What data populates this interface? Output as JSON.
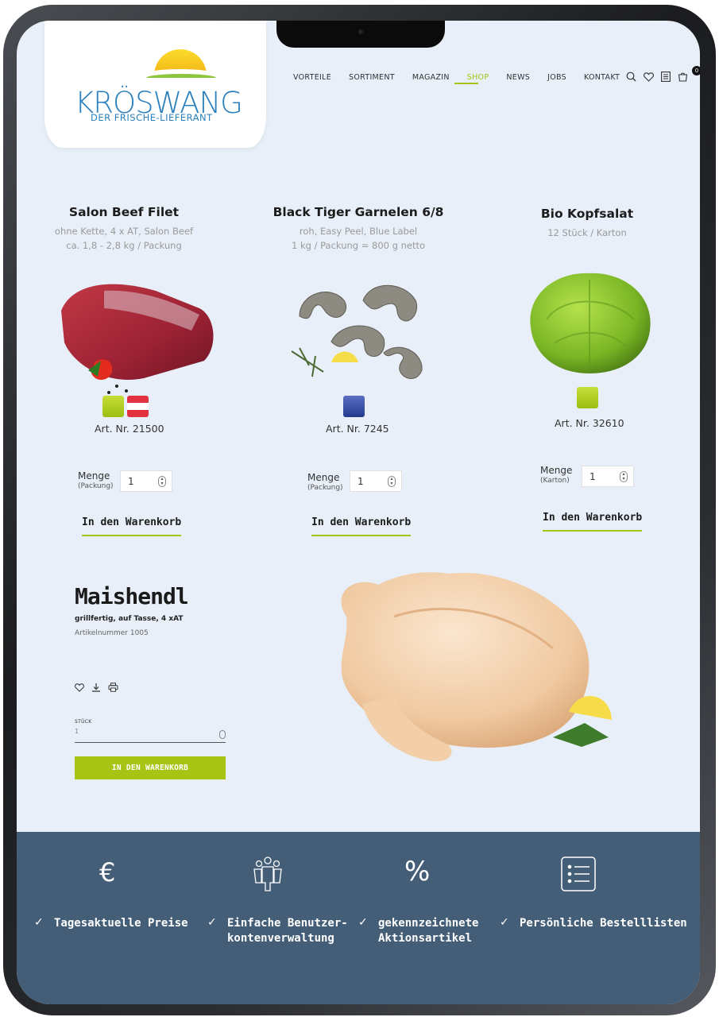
{
  "header": {
    "logo": {
      "name": "KRÖSWANG",
      "tagline": "DER FRISCHE-LIEFERANT"
    },
    "nav": [
      {
        "label": "VORTEILE",
        "active": false
      },
      {
        "label": "SORTIMENT",
        "active": false
      },
      {
        "label": "MAGAZIN",
        "active": false
      },
      {
        "label": "SHOP",
        "active": true
      },
      {
        "label": "NEWS",
        "active": false
      },
      {
        "label": "JOBS",
        "active": false
      },
      {
        "label": "KONTAKT",
        "active": false
      }
    ],
    "icons": [
      "search-icon",
      "heart-icon",
      "list-icon",
      "cart-icon"
    ],
    "cart_count": "0",
    "accent_color": "#a7c415"
  },
  "products": [
    {
      "title": "Salon Beef Filet",
      "sub1": "ohne Kette, 4 x AT, Salon Beef",
      "sub2": "ca. 1,8 - 2,8 kg / Packung",
      "art": "Art. Nr. 21500",
      "menge": "Menge",
      "unit": "(Packung)",
      "qty": "1",
      "cart": "In den Warenkorb"
    },
    {
      "title": "Black Tiger Garnelen 6/8",
      "sub1": "roh, Easy Peel, Blue Label",
      "sub2": "1 kg / Packung = 800 g netto",
      "art": "Art. Nr. 7245",
      "menge": "Menge",
      "unit": "(Packung)",
      "qty": "1",
      "cart": "In den Warenkorb"
    },
    {
      "title": "Bio Kopfsalat",
      "sub1": "12 Stück / Karton",
      "sub2": "",
      "art": "Art. Nr. 32610",
      "menge": "Menge",
      "unit": "(Karton)",
      "qty": "1",
      "cart": "In den Warenkorb"
    }
  ],
  "featured": {
    "title": "Maishendl",
    "subtitle": "grillfertig, auf Tasse, 4 xAT",
    "article": "Artikelnummer 1005",
    "qty_label": "STÜCK",
    "qty": "1",
    "button": "IN DEN WARENKORB",
    "icons": [
      "heart-icon",
      "download-icon",
      "print-icon"
    ]
  },
  "footer": {
    "features": [
      {
        "icon": "euro-icon",
        "lines": [
          "Tagesaktuelle Preise"
        ]
      },
      {
        "icon": "users-icon",
        "lines": [
          "Einfache Benutzer-",
          "kontenverwaltung"
        ]
      },
      {
        "icon": "percent-icon",
        "lines": [
          "gekennzeichnete",
          "Aktionsartikel"
        ]
      },
      {
        "icon": "checklist-icon",
        "lines": [
          "Persönliche Bestelllisten"
        ]
      }
    ]
  }
}
